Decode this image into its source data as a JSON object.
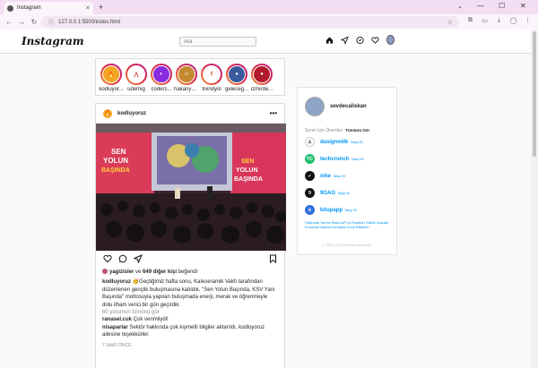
{
  "browser": {
    "tab_title": "Instagram",
    "tab_close": "×",
    "new_tab": "+",
    "url": "127.0.0.1:5500/index.html",
    "info_icon": "ⓘ",
    "back": "←",
    "forward": "→",
    "reload": "↻",
    "star": "☆",
    "minimize": "—",
    "maximize": "☐",
    "close": "✕",
    "tab_menu": "⌄"
  },
  "header": {
    "logo": "Instagram",
    "search_placeholder": "Ara"
  },
  "stories": [
    {
      "name": "kodluyor...",
      "bg": "#f6a623",
      "glyph": "🔥"
    },
    {
      "name": "udemig",
      "bg": "#ffffff",
      "glyph": "⋀"
    },
    {
      "name": "coders...",
      "bg": "#8a2be2",
      "glyph": "◐"
    },
    {
      "name": "hakanyal...",
      "bg": "#c5892f",
      "glyph": "☺"
    },
    {
      "name": "trendyol",
      "bg": "#ffffff",
      "glyph": "t"
    },
    {
      "name": "geleceg...",
      "bg": "#3a5a9c",
      "glyph": "●"
    },
    {
      "name": "izmirde...",
      "bg": "#b01a2a",
      "glyph": "●"
    }
  ],
  "post": {
    "username": "kodluyoruz",
    "more": "•••",
    "image_text": "SEN YOLUN BAŞINDA KSV YANI BAŞINDA",
    "likes_user": "yagizisler",
    "likes_mid": " ve ",
    "likes_count": "649 diğer kişi",
    "likes_tail": " beğendi",
    "caption_user": "kodluyoruz",
    "caption": " 🥳Geçtiğimiz hafta sonu, Kaleseramik Vakfı tarafından düzenlenen gençlik buluşmasına katıldık. \"Sen Yolun Başında, KSV Yanı Başında\" mottosuyla yapılan buluşmada enerji, merak ve öğrenmeyle dolu ilham verici bir gün geçirdik.",
    "view_comments": "60 yorumun tümünü gör",
    "comments": [
      {
        "user": "ranasel.cuk",
        "text": " Çok verimliydi!"
      },
      {
        "user": "nisaparlar",
        "text": " Sektör hakkında çok kıymetli bilgiler aktarıldı, kodluyoruz ailesine teşekkürler."
      }
    ],
    "time": "7 SAAT ÖNCE"
  },
  "sidebar": {
    "username": "sevdecaliskan",
    "suggest_title": "Senin İçin Önerilen",
    "see_all": "Tümünü Gör",
    "follow_label": "Takip Et",
    "suggestions": [
      {
        "name": "dasignmilk",
        "bg": "#ffffff",
        "glyph": "♙"
      },
      {
        "name": "techcrunch",
        "bg": "#1fbf6f",
        "glyph": "TC"
      },
      {
        "name": "nike",
        "bg": "#111111",
        "glyph": "✓"
      },
      {
        "name": "9GAG",
        "bg": "#111111",
        "glyph": "9"
      },
      {
        "name": "kitupapp",
        "bg": "#2f6fd9",
        "glyph": "k"
      }
    ],
    "links": "Hakkında Yardım Basın API İş Fırsatları Gizlilik Koşullar Konumlar Başlıca Hesaplar Konu Etiketleri",
    "copyright": "© 2024 INSTAGRAM by sevde"
  },
  "colors": {
    "link_blue": "#0095f6",
    "story_ring_start": "#f09433",
    "story_ring_end": "#bc1888"
  }
}
